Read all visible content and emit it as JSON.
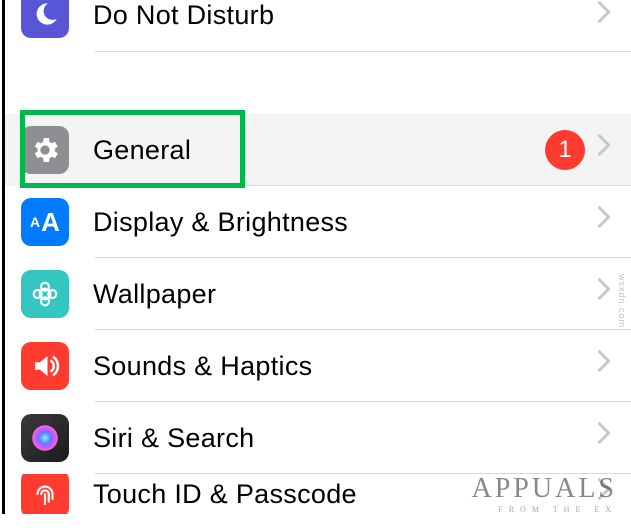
{
  "rows": {
    "dnd": {
      "label": "Do Not Disturb",
      "icon": "moon-icon",
      "icon_bg": "#5856d6"
    },
    "general": {
      "label": "General",
      "icon": "gear-icon",
      "icon_bg": "#8e8e93",
      "badge": "1",
      "highlighted": true
    },
    "display": {
      "label": "Display & Brightness",
      "icon": "text-size-icon",
      "icon_bg": "#007aff"
    },
    "wallpaper": {
      "label": "Wallpaper",
      "icon": "rosette-icon",
      "icon_bg": "#34c7c2"
    },
    "sounds": {
      "label": "Sounds & Haptics",
      "icon": "speaker-icon",
      "icon_bg": "#ff3b30"
    },
    "siri": {
      "label": "Siri & Search",
      "icon": "siri-icon",
      "icon_bg": "#1c1c1e"
    },
    "touchid": {
      "label": "Touch ID & Passcode",
      "icon": "fingerprint-icon",
      "icon_bg": "#ff3b30"
    }
  },
  "colors": {
    "highlight_box": "#00b84a",
    "badge_bg": "#ff3b30",
    "chevron": "#c7c7cc",
    "separator": "#d9d9d9",
    "row_highlight_bg": "#f4f4f4"
  },
  "watermark": {
    "main": "APPUALS",
    "sub": "FROM THE EX",
    "side": "wsxdn.com"
  }
}
